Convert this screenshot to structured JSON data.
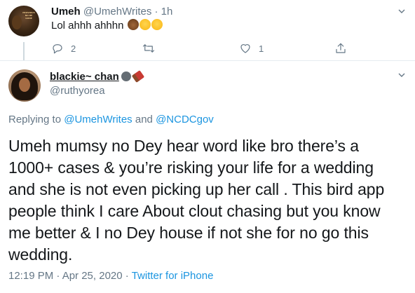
{
  "parent_tweet": {
    "name": "Umeh",
    "handle": "@UmehWrites",
    "separator": "·",
    "time": "1h",
    "text": "Lol ahhh ahhhn",
    "emojis": [
      "facepalm-emoji",
      "rofl-emoji",
      "laughing-emoji"
    ],
    "avatar_text": "PROVIDUS NO BE GONE",
    "reply_count": "2",
    "retweet_count": "",
    "like_count": "1"
  },
  "main_tweet": {
    "name": "blackie~ chan",
    "handle": "@ruthyorea",
    "replying_prefix": "Replying to",
    "reply_to_1": "@UmehWrites",
    "reply_to_and": "and",
    "reply_to_2": "@NCDCgov",
    "text_lines": [
      "Umeh mumsy no Dey hear word like bro there’s a",
      "1000+ cases & you’re risking your life for a wedding",
      "and she is not even picking up her call . This bird app",
      "people think I care About clout chasing but you know",
      "me better & I no Dey house if not she for no go this",
      "wedding."
    ],
    "timestamp": "12:19 PM · Apr 25, 2020",
    "meta_separator": "·",
    "source": "Twitter for iPhone"
  },
  "colors": {
    "text": "#14171a",
    "secondary": "#657786",
    "link": "#1b95e0",
    "divider": "#e6ecf0"
  }
}
